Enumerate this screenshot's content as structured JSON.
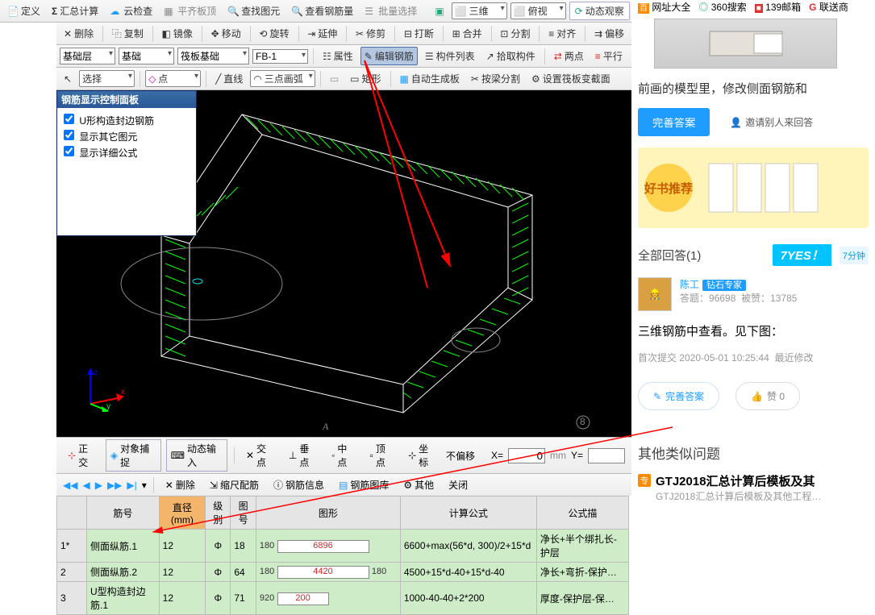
{
  "tb1": {
    "dingyi": "定义",
    "sigma": "汇总计算",
    "cloud": "云检查",
    "flat": "平齐板顶",
    "findelem": "查找图元",
    "findrebar": "查看钢筋量",
    "batchsel": "批量选择",
    "sanwei": "三维",
    "fushi": "俯视",
    "dongtai": "动态观察"
  },
  "tb2": {
    "shanchu": "删除",
    "fuzhi": "复制",
    "jingxiang": "镜像",
    "yidong": "移动",
    "xuanzhuan": "旋转",
    "yanshen": "延伸",
    "xiujian": "修剪",
    "daduan": "打断",
    "hebing": "合并",
    "fenge": "分割",
    "duiqi": "对齐",
    "pianyi": "偏移"
  },
  "tb3": {
    "sel1": "基础层",
    "sel2": "基础",
    "sel3": "筏板基础",
    "sel4": "FB-1",
    "shuxing": "属性",
    "bianji": "编辑钢筋",
    "goujian": "构件列表",
    "shiqu": "拾取构件",
    "liangdian": "两点",
    "pingxing": "平行"
  },
  "tb4": {
    "xuanze": "选择",
    "dian": "点",
    "zhixian": "直线",
    "sandianhua": "三点画弧",
    "juxing": "矩形",
    "shengcheng": "自动生成板",
    "anliang": "按梁分割",
    "shezhi": "设置筏板变截面"
  },
  "panel": {
    "title": "钢筋显示控制面板",
    "c1": "U形构造封边钢筋",
    "c2": "显示其它图元",
    "c3": "显示详细公式"
  },
  "status": {
    "zhengjiao": "正交",
    "duixiangbuchuo": "对象捕捉",
    "dongtaishuru": "动态输入",
    "jiaodian": "交点",
    "chuidian": "垂点",
    "zhongdian": "中点",
    "dingdian": "顶点",
    "zuobiao": "坐标",
    "bupianyisel": "不偏移",
    "x": "X=",
    "zero": "0",
    "mm": "mm",
    "y": "Y="
  },
  "pager": {
    "shanchu": "删除",
    "chidu": "缩尺配筋",
    "gangjin": "钢筋信息",
    "gangku": "钢筋图库",
    "qita": "其他",
    "guanbi": "关闭"
  },
  "th": {
    "jinhao": "筋号",
    "dia": "直径(mm)",
    "jibie": "级别",
    "tuhao": "图号",
    "tuxing": "图形",
    "jisuan": "计算公式",
    "gongshi": "公式描"
  },
  "rows": [
    {
      "idx": "1*",
      "name": "侧面纵筋.1",
      "dia": "12",
      "jibie": "Φ",
      "tuhao": "18",
      "s1": "180",
      "shape": "6896",
      "s2": "",
      "formula": "6600+max(56*d, 300)/2+15*d",
      "desc": "净长+半个绑扎长-护层"
    },
    {
      "idx": "2",
      "name": "侧面纵筋.2",
      "dia": "12",
      "jibie": "Φ",
      "tuhao": "64",
      "s1": "180",
      "shape": "4420",
      "s2": "180",
      "formula": "4500+15*d-40+15*d-40",
      "desc": "净长+弯折-保护…"
    },
    {
      "idx": "3",
      "name": "U型构造封边筋.1",
      "dia": "12",
      "jibie": "Φ",
      "tuhao": "71",
      "s1": "920",
      "shape": "200",
      "s2": "",
      "formula": "1000-40-40+2*200",
      "desc": "厚度-保护层-保…"
    }
  ],
  "right": {
    "topicons": {
      "wz": "网址大全",
      "s360": "360搜索",
      "mail": "139邮箱",
      "liansong": "联送商"
    },
    "hint": "前画的模型里，修改侧面钢筋和",
    "improve": "完善答案",
    "invite": "邀请别人来回答",
    "promo": "好书推荐",
    "allans": "全部回答(1)",
    "yes": "YES！",
    "yes2": "7分钟",
    "user": "陈工",
    "badge": "钻石专家",
    "ans_c_l": "答题：",
    "ans_c": "96698",
    "liked_l": "被赞：",
    "liked": "13785",
    "reply": "三维钢筋中查看。见下图：",
    "first": "首次提交",
    "date": "2020-05-01 10:25:44",
    "last": "最近修改",
    "btn_imp": "完善答案",
    "btn_like": "赞 0",
    "other": "其他类似问题",
    "q1": "GTJ2018汇总计算后模板及其",
    "q1sub": "GTJ2018汇总计算后模板及其他工程…"
  },
  "axes": {
    "z": "z",
    "x": "x",
    "y": "y"
  },
  "node_a": "A",
  "node_8": "8"
}
